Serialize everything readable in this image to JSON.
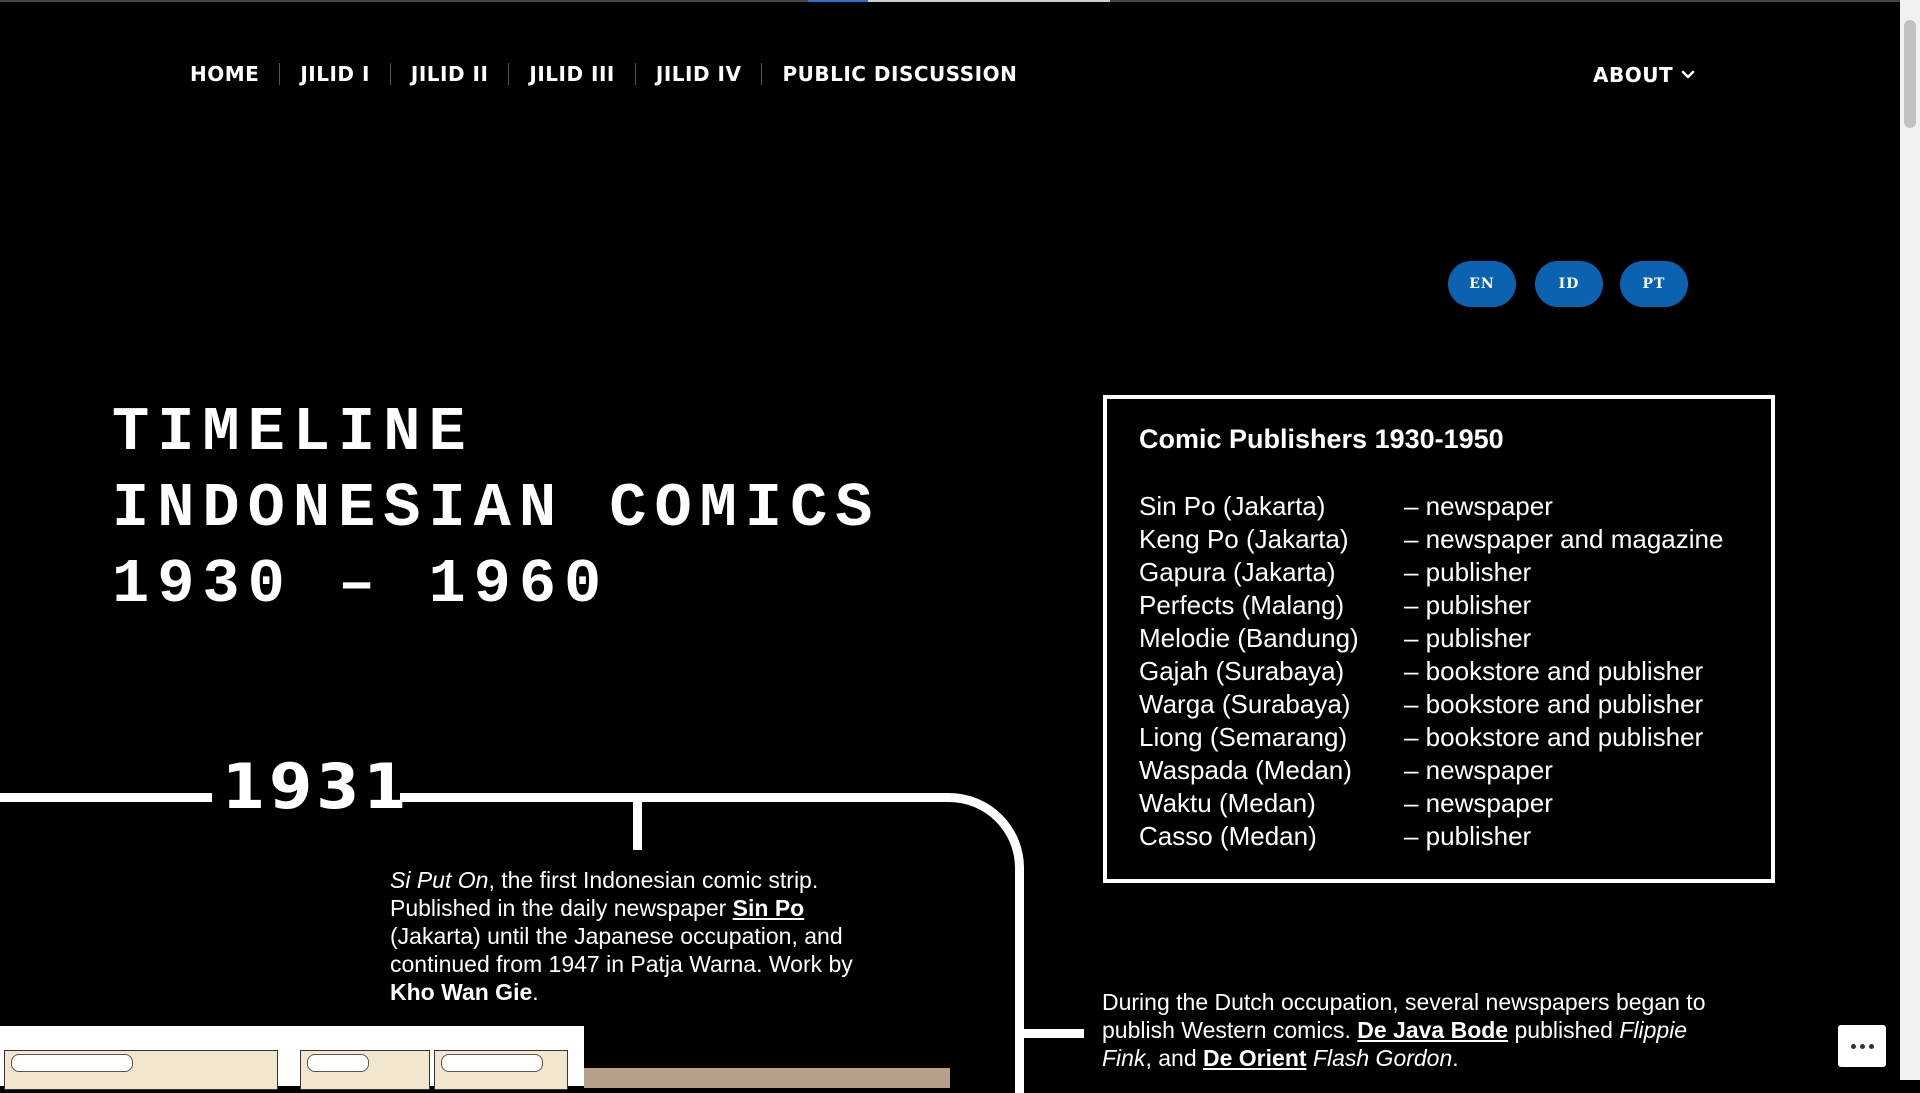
{
  "nav": {
    "items": [
      "HOME",
      "JILID I",
      "JILID II",
      "JILID III",
      "JILID IV",
      "PUBLIC DISCUSSION"
    ],
    "about": "ABOUT"
  },
  "languages": [
    "EN",
    "ID",
    "PT"
  ],
  "hero": {
    "title_lines": [
      "TIMELINE",
      "INDONESIAN COMICS",
      "1930 – 1960"
    ]
  },
  "publishers": {
    "title": "Comic Publishers 1930-1950",
    "rows": [
      {
        "name": "Sin Po (Jakarta)",
        "kind": "– newspaper"
      },
      {
        "name": "Keng Po (Jakarta)",
        "kind": "– newspaper and magazine"
      },
      {
        "name": "Gapura (Jakarta)",
        "kind": "– publisher"
      },
      {
        "name": "Perfects (Malang)",
        "kind": "– publisher"
      },
      {
        "name": "Melodie (Bandung)",
        "kind": "– publisher"
      },
      {
        "name": "Gajah (Surabaya)",
        "kind": "– bookstore and publisher"
      },
      {
        "name": "Warga (Surabaya)",
        "kind": "– bookstore and publisher"
      },
      {
        "name": "Liong (Semarang)",
        "kind": "– bookstore and publisher"
      },
      {
        "name": "Waspada (Medan)",
        "kind": "– newspaper"
      },
      {
        "name": "Waktu (Medan)",
        "kind": "– newspaper"
      },
      {
        "name": "Casso (Medan)",
        "kind": "– publisher"
      }
    ]
  },
  "timeline": {
    "year": "1931",
    "entry1": {
      "title_italic": "Si Put On",
      "text_a": ", the first Indonesian comic strip. Published in the daily newspaper ",
      "link": "Sin Po",
      "text_b": " (Jakarta) until the Japanese occupation, and continued from 1947 in Patja Warna. Work by ",
      "author": "Kho Wan Gie",
      "text_c": "."
    },
    "entry2": {
      "text_a": "During the Dutch occupation, several newspapers began to publish Western comics. ",
      "link1": "De Java Bode",
      "text_b": " published ",
      "italic1": "Flippie Fink",
      "text_c": ", and ",
      "link2": "De Orient",
      "text_d": " ",
      "italic2": "Flash Gordon",
      "text_e": "."
    }
  },
  "colors": {
    "background": "#000000",
    "accent": "#0a62b0",
    "text": "#ffffff"
  },
  "icons": [
    "chevron-down-icon",
    "more-options-icon"
  ]
}
